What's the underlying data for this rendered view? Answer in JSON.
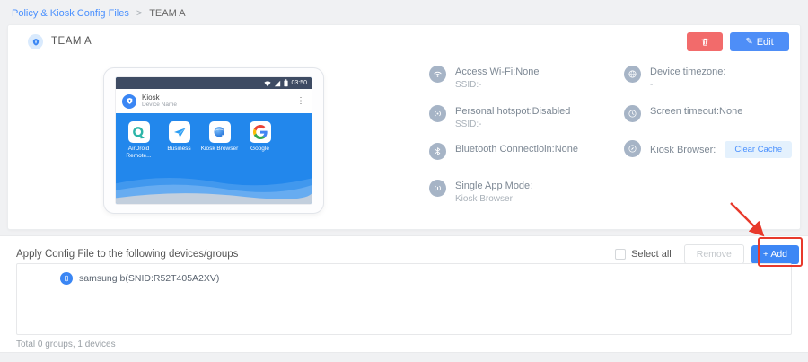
{
  "breadcrumb": {
    "link": "Policy & Kiosk Config Files",
    "separator": ">",
    "current": "TEAM A"
  },
  "header": {
    "title": "TEAM A",
    "edit": "Edit"
  },
  "preview": {
    "time": "03:50",
    "app_title": "Kiosk",
    "app_subtitle": "Device Name",
    "menu": "⋮",
    "apps": [
      {
        "label": "AirDroid Remote..."
      },
      {
        "label": "Business"
      },
      {
        "label": "Kiosk Browser"
      },
      {
        "label": "Google"
      }
    ]
  },
  "settings": {
    "left": [
      {
        "title": "Access Wi-Fi:None",
        "subtitle": "SSID:-"
      },
      {
        "title": "Personal hotspot:Disabled",
        "subtitle": "SSID:-"
      },
      {
        "title": "Bluetooth Connectioin:None",
        "subtitle": ""
      },
      {
        "title": "Single App Mode:",
        "subtitle": "Kiosk Browser"
      }
    ],
    "right": [
      {
        "title": "Device timezone:",
        "subtitle": "-"
      },
      {
        "title": "Screen timeout:None",
        "subtitle": ""
      },
      {
        "title": "Kiosk Browser:",
        "action": "Clear Cache"
      }
    ]
  },
  "apply": {
    "title": "Apply Config File to the following devices/groups",
    "select_all": "Select all",
    "remove": "Remove",
    "add": "+ Add",
    "devices": [
      {
        "name": "samsung b(SNID:R52T405A2XV)"
      }
    ],
    "total": "Total 0 groups, 1 devices"
  },
  "colors": {
    "accent": "#3d87f5",
    "link": "#4a90fe",
    "danger": "#f26b6b",
    "annotation": "#e8392b",
    "muted_icon": "#a6b4c6"
  }
}
